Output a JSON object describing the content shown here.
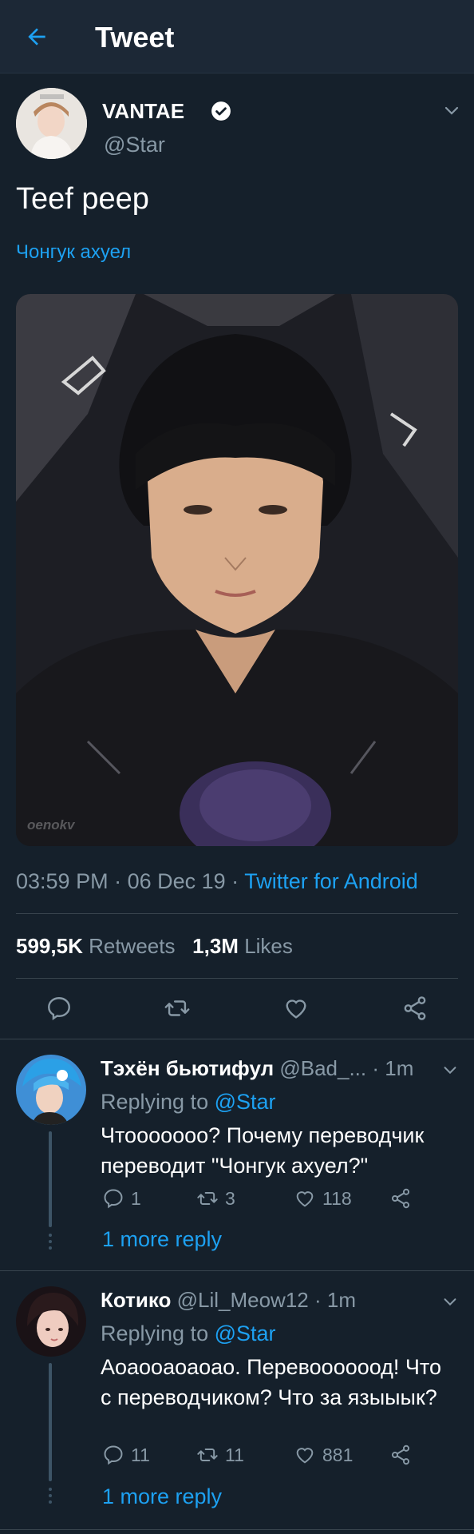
{
  "header": {
    "title": "Tweet",
    "back_icon": "back-arrow-icon"
  },
  "tweet": {
    "author_name": "VANTAE",
    "author_handle": "@Star",
    "text": "Teef peep",
    "translate_text": "Чонгук ахуел",
    "image_watermark": "oenokv",
    "time": "03:59 PM",
    "date": "06 Dec 19",
    "source": "Twitter for Android",
    "retweets_count": "599,5K",
    "retweets_label": "Retweets",
    "likes_count": "1,3M",
    "likes_label": "Likes"
  },
  "replies": [
    {
      "name": "Тэхён бьютифул",
      "handle": "@Bad_...",
      "time": "1m",
      "replying_prefix": "Replying to",
      "replying_to": "@Star",
      "text": "Чтоооoooo? Почему переводчик переводит \"Чонгук ахуел?\"",
      "replies": "1",
      "retweets": "3",
      "likes": "118",
      "more": "1 more reply"
    },
    {
      "name": "Котико",
      "handle": "@Lil_Meow12",
      "time": "1m",
      "replying_prefix": "Replying to",
      "replying_to": "@Star",
      "text": "Аоаооаоаоао. Перевоооооод! Что с переводчиком? Что за языыык?",
      "replies": "11",
      "retweets": "11",
      "likes": "881",
      "more": "1 more reply"
    }
  ],
  "colors": {
    "background": "#15202b",
    "header": "#1c2836",
    "accent": "#1da1f2",
    "muted": "#8899a6",
    "divider": "#38444d"
  }
}
